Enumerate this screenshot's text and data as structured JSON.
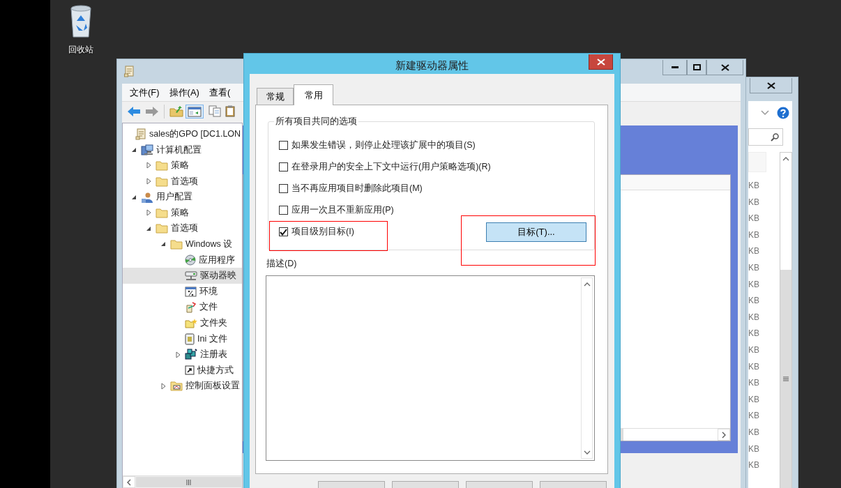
{
  "desktop": {
    "icons": [
      {
        "label": "回收站"
      }
    ]
  },
  "back_window": {
    "size_cells": [
      "KB",
      "KB",
      "KB",
      "KB",
      "KB",
      "KB",
      "KB",
      "KB",
      "KB",
      "KB",
      "KB",
      "KB",
      "KB",
      "KB",
      "KB",
      "KB",
      "KB",
      "KB"
    ]
  },
  "editor_window": {
    "menu": [
      {
        "label": "文件(F)"
      },
      {
        "label": "操作(A)"
      },
      {
        "label": "查看("
      }
    ],
    "tree": [
      {
        "label": "sales的GPO [DC1.LON",
        "kind": "gpo",
        "selected": false,
        "children": [
          {
            "label": "计算机配置",
            "kind": "computer",
            "selected": false,
            "expanded": true,
            "children": [
              {
                "label": "策略",
                "kind": "folder",
                "selected": false,
                "expanded": false
              },
              {
                "label": "首选项",
                "kind": "folder",
                "selected": false,
                "expanded": false
              }
            ]
          },
          {
            "label": "用户配置",
            "kind": "user",
            "selected": false,
            "expanded": true,
            "children": [
              {
                "label": "策略",
                "kind": "folder",
                "selected": false,
                "expanded": false
              },
              {
                "label": "首选项",
                "kind": "folder",
                "selected": false,
                "expanded": true,
                "children": [
                  {
                    "label": "Windows 设",
                    "kind": "folder",
                    "selected": false,
                    "expanded": true,
                    "children": [
                      {
                        "label": "应用程序",
                        "kind": "app",
                        "selected": false
                      },
                      {
                        "label": "驱动器映",
                        "kind": "drive",
                        "selected": true
                      },
                      {
                        "label": "环境",
                        "kind": "env",
                        "selected": false
                      },
                      {
                        "label": "文件",
                        "kind": "file",
                        "selected": false
                      },
                      {
                        "label": "文件夹",
                        "kind": "newfolder",
                        "selected": false
                      },
                      {
                        "label": "Ini 文件",
                        "kind": "ini",
                        "selected": false
                      },
                      {
                        "label": "注册表",
                        "kind": "registry",
                        "selected": false,
                        "expanded": false
                      },
                      {
                        "label": "快捷方式",
                        "kind": "shortcut",
                        "selected": false
                      }
                    ]
                  },
                  {
                    "label": "控制面板设置",
                    "kind": "cpanel",
                    "selected": false,
                    "expanded": false
                  }
                ]
              }
            ]
          }
        ]
      }
    ]
  },
  "dialog": {
    "title": "新建驱动器属性",
    "tabs": [
      {
        "label": "常规",
        "selected": false
      },
      {
        "label": "常用",
        "selected": true
      }
    ],
    "group_title": "所有项目共同的选项",
    "options": [
      {
        "label": "如果发生错误，则停止处理该扩展中的项目(S)",
        "checked": false
      },
      {
        "label": "在登录用户的安全上下文中运行(用户策略选项)(R)",
        "checked": false
      },
      {
        "label": "当不再应用项目时删除此项目(M)",
        "checked": false
      },
      {
        "label": "应用一次且不重新应用(P)",
        "checked": false
      },
      {
        "label": "项目级别目标(I)",
        "checked": true
      }
    ],
    "targeting_button": "目标(T)...",
    "description_label": "描述(D)"
  }
}
